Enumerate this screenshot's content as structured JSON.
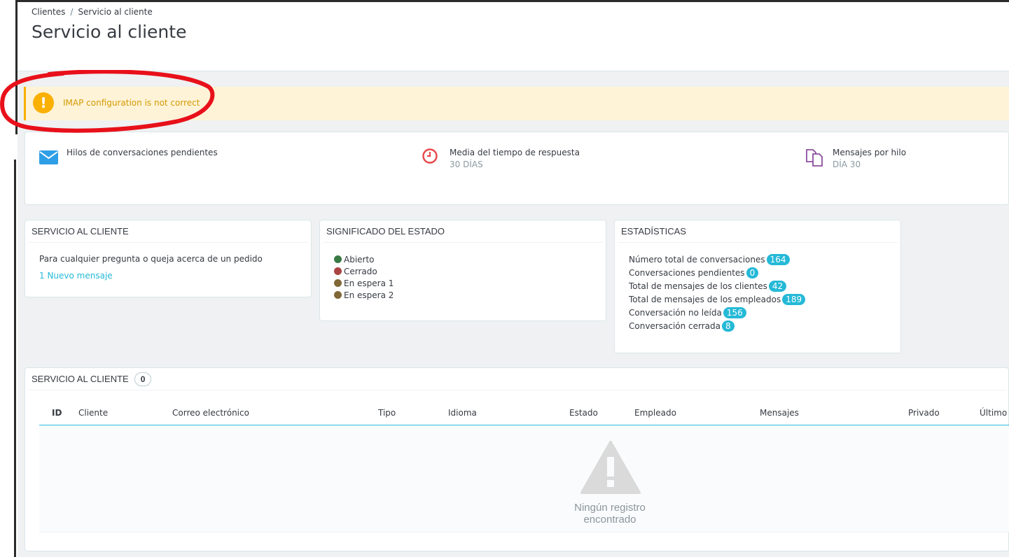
{
  "breadcrumb": {
    "parent": "Clientes",
    "separator": "/",
    "current": "Servicio al cliente"
  },
  "page_title": "Servicio al cliente",
  "alert": {
    "icon": "exclamation-icon",
    "text": "IMAP configuration is not correct"
  },
  "kpis": [
    {
      "icon": "envelope-icon",
      "label": "Hilos de conversaciones pendientes",
      "sub": ""
    },
    {
      "icon": "clock-icon",
      "label": "Media del tiempo de respuesta",
      "sub": "30 DÍAS"
    },
    {
      "icon": "documents-icon",
      "label": "Mensajes por hilo",
      "sub": "DÍA 30"
    }
  ],
  "customer_service": {
    "title": "SERVICIO AL CLIENTE",
    "desc": "Para cualquier pregunta o queja acerca de un pedido",
    "link": "1 Nuevo mensaje"
  },
  "status_meaning": {
    "title": "SIGNIFICADO DEL ESTADO",
    "items": [
      {
        "label": "Abierto",
        "color": "#3a7a45"
      },
      {
        "label": "Cerrado",
        "color": "#a94442"
      },
      {
        "label": "En espera 1",
        "color": "#806837"
      },
      {
        "label": "En espera 2",
        "color": "#806837"
      }
    ]
  },
  "stats": {
    "title": "ESTADÍSTICAS",
    "rows": [
      {
        "label": "Número total de conversaciones",
        "value": "164"
      },
      {
        "label": "Conversaciones pendientes",
        "value": "0"
      },
      {
        "label": "Total de mensajes de los clientes",
        "value": "42"
      },
      {
        "label": "Total de mensajes de los empleados",
        "value": "189"
      },
      {
        "label": "Conversación no leída",
        "value": "156"
      },
      {
        "label": "Conversación cerrada",
        "value": "8"
      }
    ]
  },
  "list": {
    "title": "SERVICIO AL CLIENTE",
    "count": "0",
    "columns": [
      "ID",
      "Cliente",
      "Correo electrónico",
      "Tipo",
      "Idioma",
      "Estado",
      "Empleado",
      "Mensajes",
      "Privado",
      "Último m"
    ],
    "empty_text": "Ningún registro encontrado"
  },
  "colors": {
    "accent": "#25b9d7",
    "warning": "#fab000",
    "warning_bg": "#fff3d7",
    "annotation": "#e8101a"
  }
}
